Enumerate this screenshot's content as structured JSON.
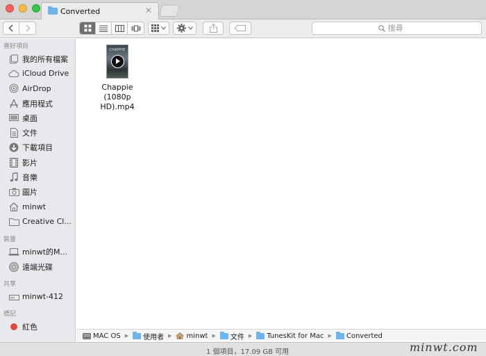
{
  "window": {
    "tab_title": "Converted",
    "tab_close": "✕"
  },
  "toolbar": {
    "search_placeholder": "搜尋"
  },
  "sidebar": {
    "favorites_title": "喜好項目",
    "favorites": [
      {
        "label": "我的所有檔案",
        "icon": "all-files-icon"
      },
      {
        "label": "iCloud Drive",
        "icon": "cloud-icon"
      },
      {
        "label": "AirDrop",
        "icon": "airdrop-icon"
      },
      {
        "label": "應用程式",
        "icon": "applications-icon"
      },
      {
        "label": "桌面",
        "icon": "desktop-icon"
      },
      {
        "label": "文件",
        "icon": "documents-icon"
      },
      {
        "label": "下載項目",
        "icon": "downloads-icon"
      },
      {
        "label": "影片",
        "icon": "movies-icon"
      },
      {
        "label": "音樂",
        "icon": "music-icon"
      },
      {
        "label": "圖片",
        "icon": "pictures-icon"
      },
      {
        "label": "minwt",
        "icon": "home-icon"
      },
      {
        "label": "Creative Cl...",
        "icon": "folder-icon"
      }
    ],
    "devices_title": "裝置",
    "devices": [
      {
        "label": "minwt的M...",
        "icon": "laptop-icon"
      },
      {
        "label": "遠端光碟",
        "icon": "disc-icon"
      }
    ],
    "shared_title": "共享",
    "shared": [
      {
        "label": "minwt-412",
        "icon": "nas-icon"
      }
    ],
    "tags_title": "標記",
    "tags": [
      {
        "label": "紅色",
        "color": "#e2473f"
      }
    ]
  },
  "content": {
    "file": {
      "thumb_title": "CHAPPIE",
      "name_line1": "Chappie (1080p",
      "name_line2": "HD).mp4"
    }
  },
  "pathbar": {
    "items": [
      {
        "label": "MAC OS",
        "icon": "drive-icon"
      },
      {
        "label": "使用者",
        "icon": "folder-icon"
      },
      {
        "label": "minwt",
        "icon": "home-icon"
      },
      {
        "label": "文件",
        "icon": "folder-icon"
      },
      {
        "label": "TunesKit for Mac",
        "icon": "folder-icon"
      },
      {
        "label": "Converted",
        "icon": "folder-icon"
      }
    ]
  },
  "status": {
    "text": "1 個項目，17.09 GB 可用"
  },
  "watermark": "minwt.com",
  "colors": {
    "accent_folder": "#6cb4ee",
    "sidebar_bg": "#e7e9ec",
    "tag_red": "#e2473f"
  }
}
